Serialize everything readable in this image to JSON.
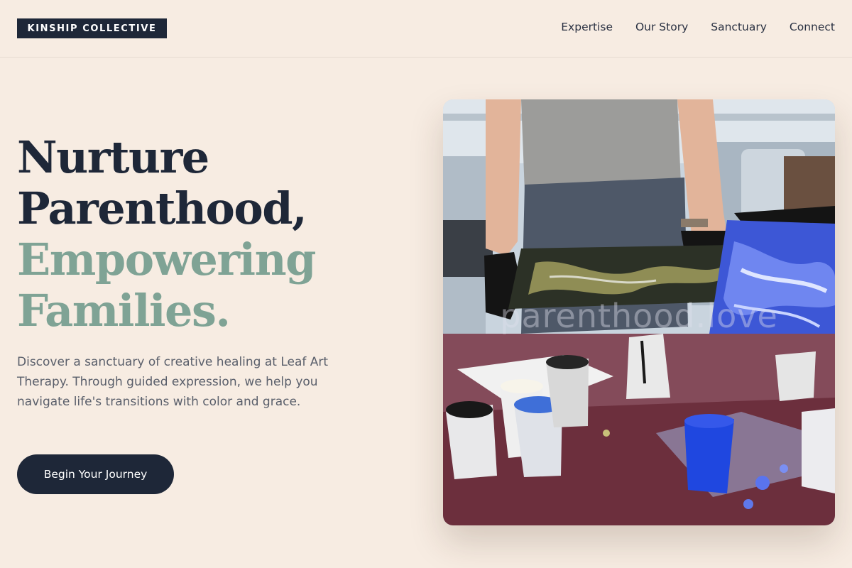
{
  "brand": {
    "name": "KINSHIP COLLECTIVE"
  },
  "nav": {
    "items": [
      "Expertise",
      "Our Story",
      "Sanctuary",
      "Connect"
    ]
  },
  "hero": {
    "headline_line1": "Nurture",
    "headline_line2": "Parenthood,",
    "headline_line3": "Empowering",
    "headline_line4": "Families.",
    "description": "Discover a sanctuary of creative healing at Leaf Art Therapy. Through guided expression, we help you navigate life's transitions with color and grace.",
    "cta_label": "Begin Your Journey",
    "image_watermark": "parenthood.love"
  },
  "colors": {
    "background": "#f7ece2",
    "navy": "#1e2738",
    "sage": "#7fa395",
    "body_text": "#5a5f6b"
  }
}
